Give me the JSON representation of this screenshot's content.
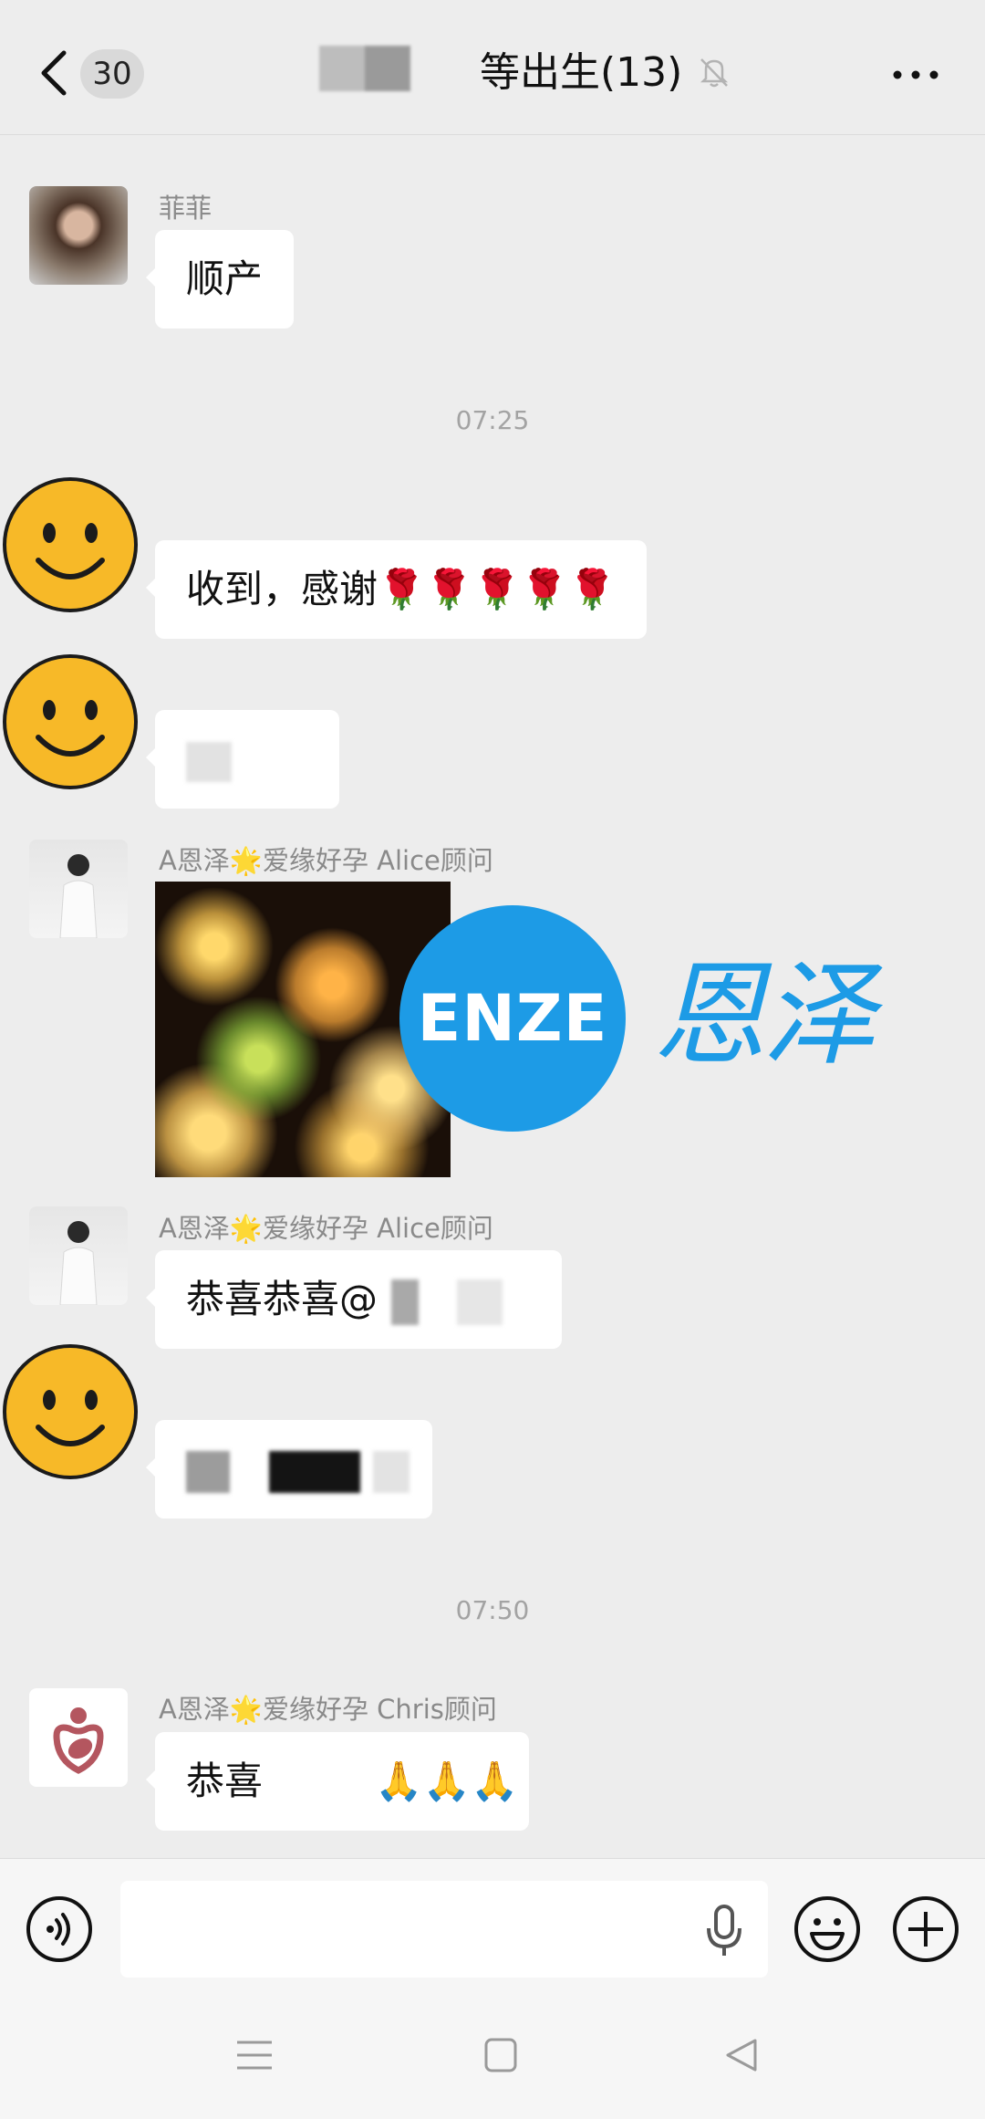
{
  "header": {
    "back_count": "30",
    "title": "等出生(13)",
    "icons": [
      "back-icon",
      "mute-icon",
      "more-icon"
    ]
  },
  "messages": [
    {
      "sender": "菲菲",
      "text": "顺产"
    },
    {
      "text": "收到，感谢🌹🌹🌹🌹🌹"
    },
    {
      "sender": "A恩泽🌟爱缘好孕 Alice顾问",
      "type": "image"
    },
    {
      "sender": "A恩泽🌟爱缘好孕 Alice顾问",
      "text": "恭喜恭喜@"
    },
    {
      "sender": "A恩泽🌟爱缘好孕 Chris顾问",
      "text_prefix": "恭喜",
      "text_suffix": "🙏🙏🙏"
    }
  ],
  "timestamps": [
    "07:25",
    "07:50"
  ],
  "watermark": {
    "brand": "ENZE",
    "name": "恩泽",
    "color": "#1d9be6"
  },
  "input": {
    "placeholder": ""
  },
  "colors": {
    "background": "#ededed",
    "bubble": "#ffffff",
    "sender": "#8a8a8a"
  }
}
